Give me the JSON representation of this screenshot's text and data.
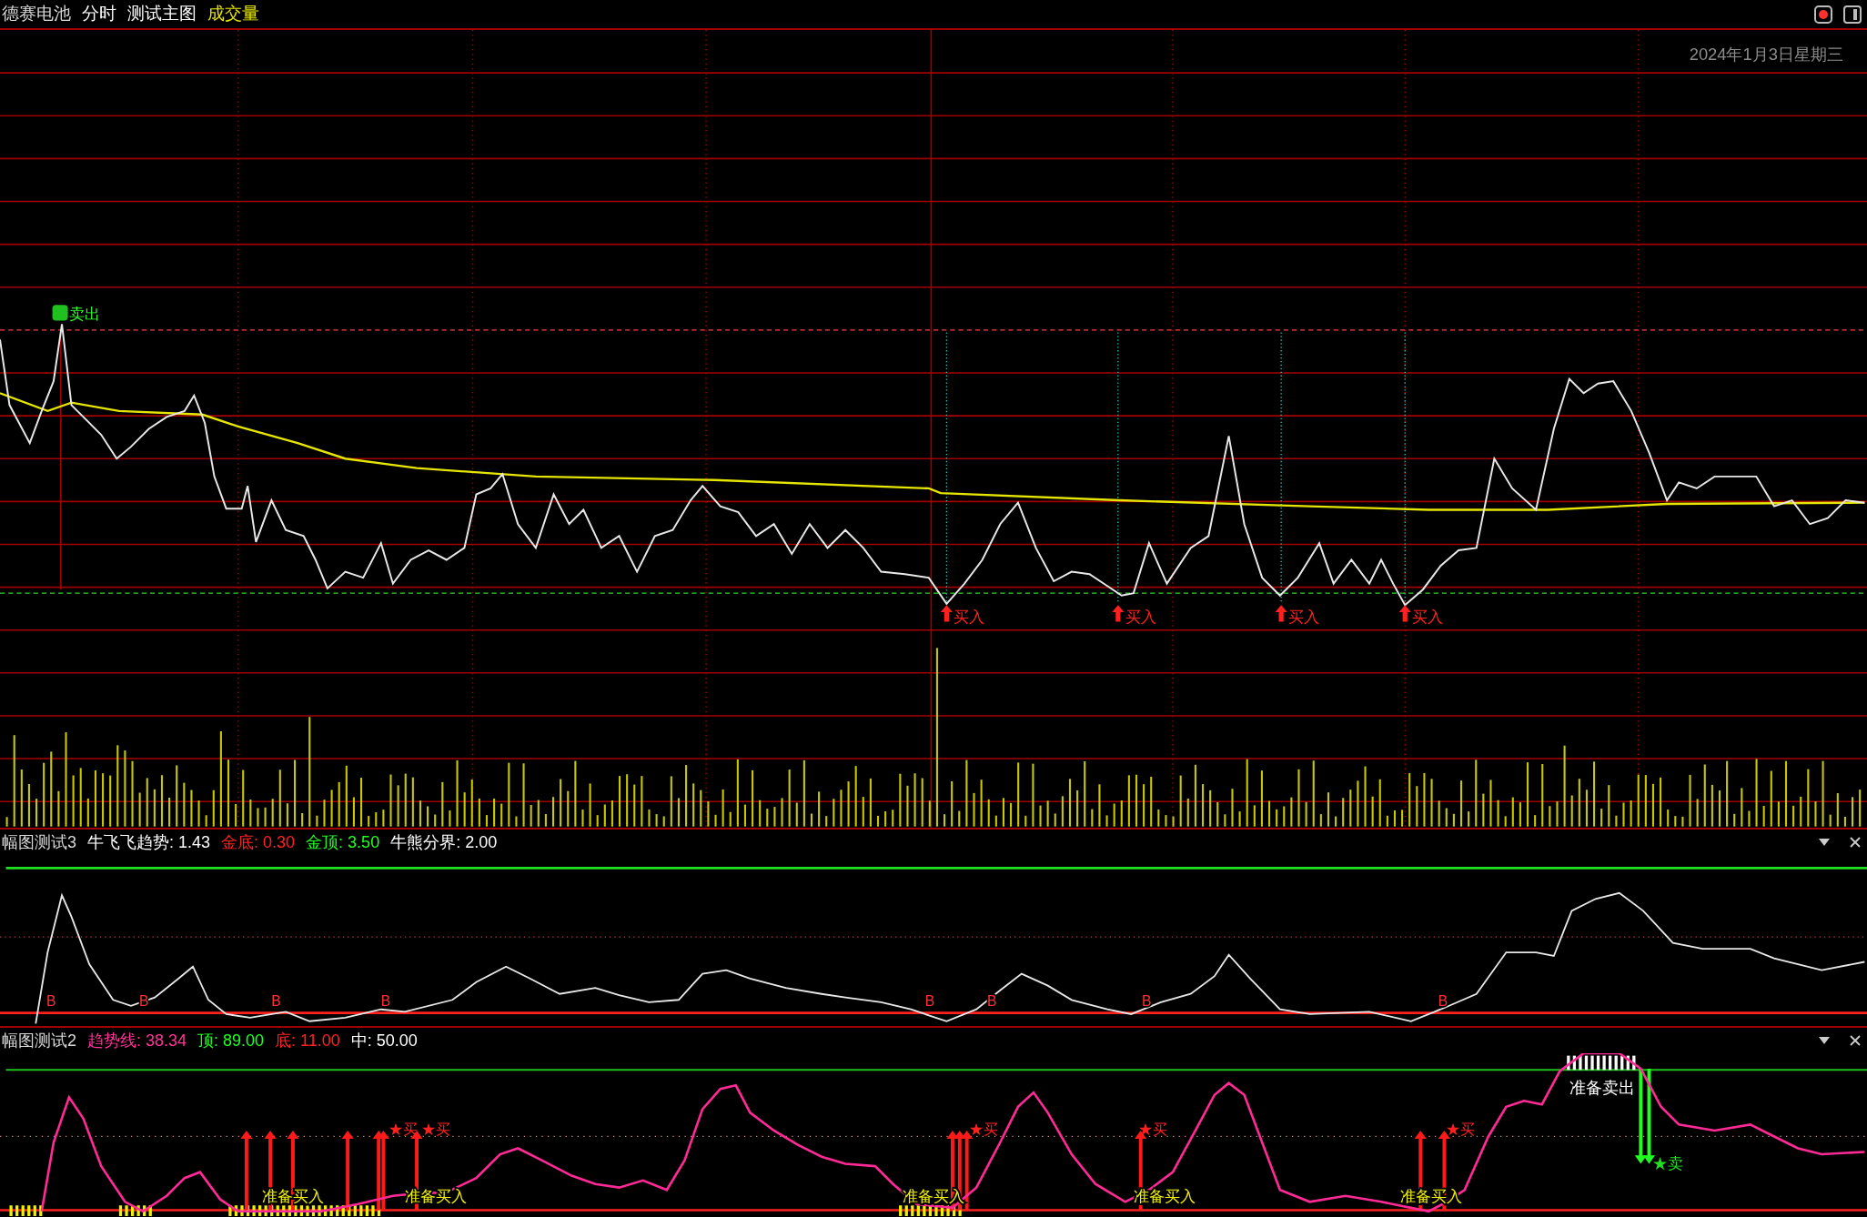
{
  "header": {
    "items": [
      {
        "text": "德赛电池",
        "color": "#d8d8d8"
      },
      {
        "text": "分时",
        "color": "#ffffff"
      },
      {
        "text": "测试主图",
        "color": "#ffffff"
      },
      {
        "text": "成交量",
        "color": "#e6e600"
      }
    ]
  },
  "date": "2024年1月3日星期三",
  "main_chart": {
    "sell_label": "卖出",
    "buy_labels": [
      "买入",
      "买入",
      "买入",
      "买入"
    ]
  },
  "panels": [
    {
      "title": "幅图测试3",
      "items": [
        {
          "label": "牛飞飞趋势:",
          "value": "1.43",
          "color": "#ffffff"
        },
        {
          "label": "金底:",
          "value": "0.30",
          "color": "#ff2020"
        },
        {
          "label": "金顶:",
          "value": "3.50",
          "color": "#20ff20"
        },
        {
          "label": "牛熊分界:",
          "value": "2.00",
          "color": "#ffffff"
        }
      ],
      "markers": [
        "B",
        "B",
        "B",
        "B",
        "B",
        "B",
        "B",
        "B"
      ]
    },
    {
      "title": "幅图测试2",
      "items": [
        {
          "label": "趋势线:",
          "value": "38.34",
          "color": "#ff3399"
        },
        {
          "label": "顶:",
          "value": "89.00",
          "color": "#20ff20"
        },
        {
          "label": "底:",
          "value": "11.00",
          "color": "#ff2020"
        },
        {
          "label": "中:",
          "value": "50.00",
          "color": "#ffffff"
        }
      ],
      "buy_stars": [
        "★买",
        "★买",
        "★买",
        "★买",
        "★买"
      ],
      "prepare_buy": [
        "准备买入",
        "准备买入",
        "准备买入",
        "准备买入",
        "准备买入"
      ],
      "prepare_sell": "准备卖出",
      "sell_star": "★卖"
    }
  ]
}
